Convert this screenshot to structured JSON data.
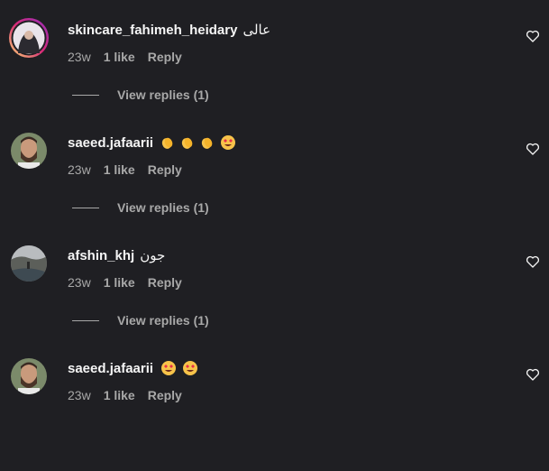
{
  "comments": [
    {
      "username": "skincare_fahimeh_heidary",
      "text": "عالی",
      "emoji": [],
      "time": "23w",
      "likes": "1 like",
      "reply": "Reply",
      "view_replies": "View replies (1)",
      "avatar": "woman-hijab-avatar",
      "story_ring": true
    },
    {
      "username": "saeed.jafaarii",
      "text": "",
      "emoji": [
        "clapping-hands-icon",
        "clapping-hands-icon",
        "clapping-hands-icon",
        "heart-eyes-icon"
      ],
      "time": "23w",
      "likes": "1 like",
      "reply": "Reply",
      "view_replies": "View replies (1)",
      "avatar": "bearded-man-avatar",
      "story_ring": false
    },
    {
      "username": "afshin_khj",
      "text": "جون",
      "emoji": [],
      "time": "23w",
      "likes": "1 like",
      "reply": "Reply",
      "view_replies": "View replies (1)",
      "avatar": "landscape-avatar",
      "story_ring": false
    },
    {
      "username": "saeed.jafaarii",
      "text": "",
      "emoji": [
        "heart-eyes-icon",
        "heart-eyes-icon"
      ],
      "time": "23w",
      "likes": "1 like",
      "reply": "Reply",
      "view_replies": "",
      "avatar": "bearded-man-avatar",
      "story_ring": false
    }
  ],
  "colors": {
    "background": "#1f1f23",
    "muted": "#a8a8a8",
    "text": "#f5f5f5"
  }
}
